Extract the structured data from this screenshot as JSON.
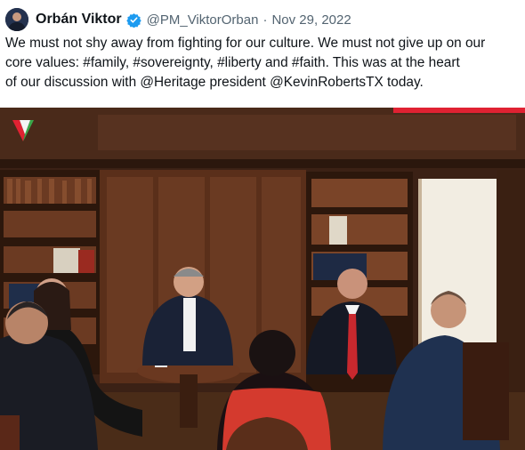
{
  "tweet": {
    "author_name": "Orbán Viktor",
    "handle": "@PM_ViktorOrban",
    "separator": "·",
    "date": "Nov 29, 2022",
    "text_lines": [
      "We must not shy away from fighting for our culture. We must not give up on our",
      "core values: #family, #sovereignty, #liberty and #faith. This was at the heart",
      "of our discussion with @Heritage president @KevinRobertsTX today."
    ],
    "icons": {
      "verified": "verified-badge-icon",
      "logo": "channel-logo-icon"
    }
  },
  "colors": {
    "verified_blue": "#1d9bf0",
    "text": "#0f1419",
    "muted": "#536471",
    "accent_red": "#e02232"
  }
}
